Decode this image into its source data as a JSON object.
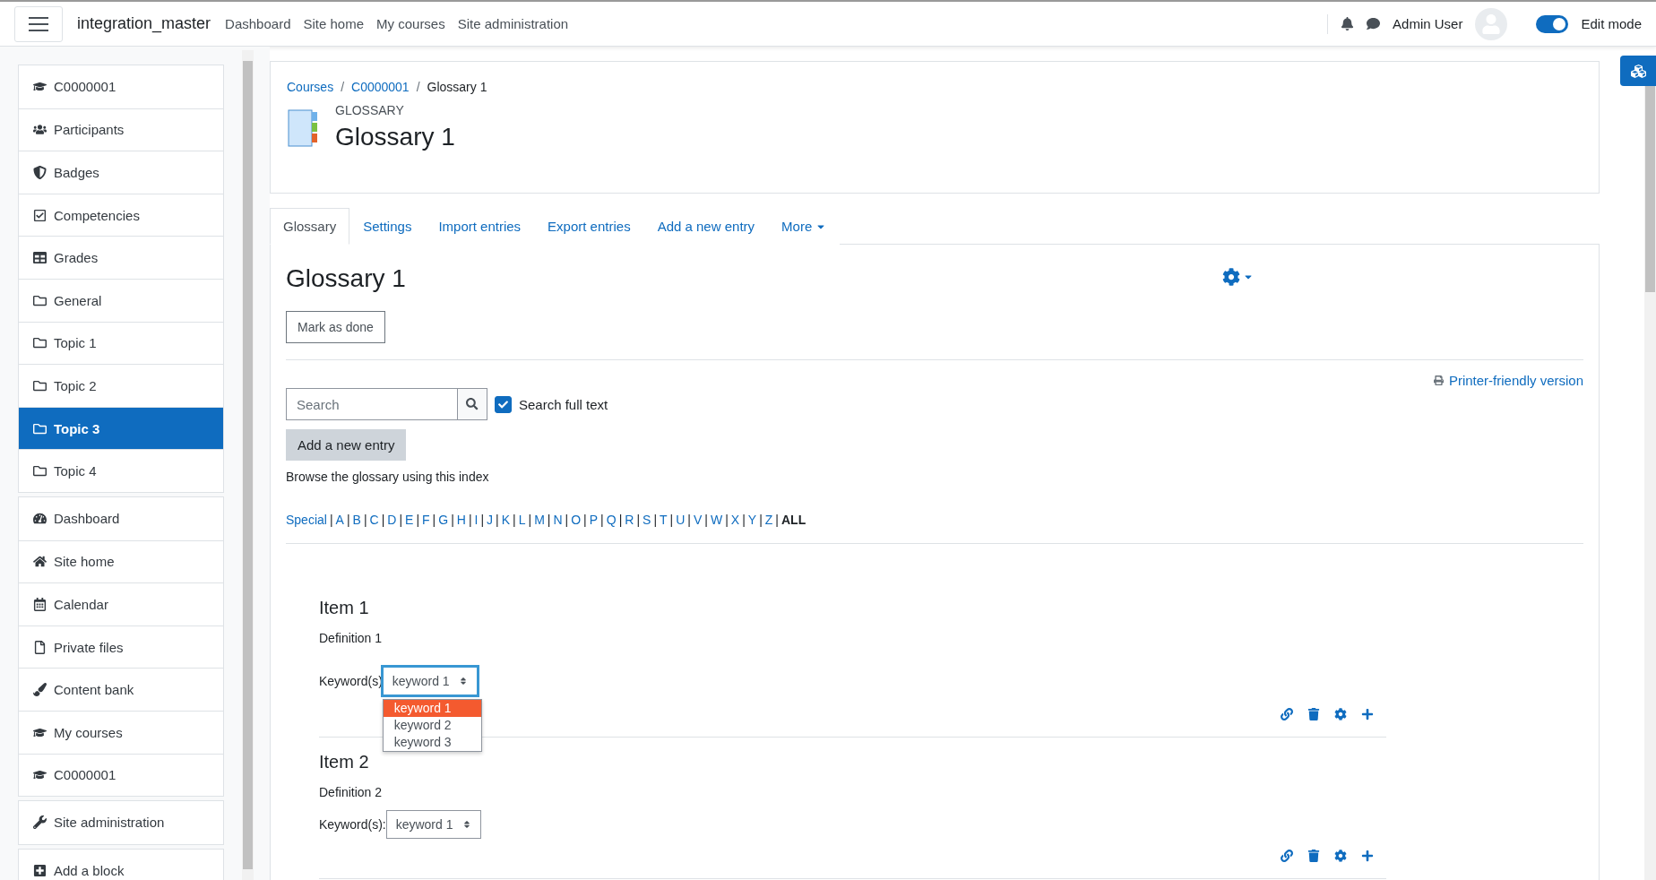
{
  "navbar": {
    "brand": "integration_master",
    "links": [
      "Dashboard",
      "Site home",
      "My courses",
      "Site administration"
    ],
    "user_name": "Admin User",
    "edit_mode": {
      "label": "Edit mode",
      "on": true
    }
  },
  "sidebar": {
    "groups": [
      {
        "items": [
          {
            "label": "C0000001",
            "selected": false
          },
          {
            "label": "Participants",
            "selected": false
          },
          {
            "label": "Badges",
            "selected": false
          },
          {
            "label": "Competencies",
            "selected": false
          },
          {
            "label": "Grades",
            "selected": false
          },
          {
            "label": "General",
            "selected": false
          },
          {
            "label": "Topic 1",
            "selected": false
          },
          {
            "label": "Topic 2",
            "selected": false
          },
          {
            "label": "Topic 3",
            "selected": true
          },
          {
            "label": "Topic 4",
            "selected": false
          }
        ]
      },
      {
        "items": [
          {
            "label": "Dashboard",
            "selected": false
          },
          {
            "label": "Site home",
            "selected": false
          },
          {
            "label": "Calendar",
            "selected": false
          },
          {
            "label": "Private files",
            "selected": false
          },
          {
            "label": "Content bank",
            "selected": false
          },
          {
            "label": "My courses",
            "selected": false
          },
          {
            "label": "C0000001",
            "selected": false
          }
        ]
      },
      {
        "items": [
          {
            "label": "Site administration",
            "selected": false
          }
        ]
      },
      {
        "items": [
          {
            "label": "Add a block",
            "selected": false
          }
        ]
      }
    ]
  },
  "header": {
    "breadcrumb": [
      {
        "label": "Courses"
      },
      {
        "label": "C0000001",
        "sep": "/"
      },
      {
        "label": "Glossary 1",
        "sep": "/"
      }
    ],
    "module_type": "GLOSSARY",
    "title": "Glossary 1"
  },
  "tabs": [
    {
      "label": "Glossary",
      "selected": true,
      "kind": "link"
    },
    {
      "label": "Settings",
      "selected": false,
      "kind": "link"
    },
    {
      "label": "Import entries",
      "selected": false,
      "kind": "link"
    },
    {
      "label": "Export entries",
      "selected": false,
      "kind": "link"
    },
    {
      "label": "Add a new entry",
      "selected": false,
      "kind": "link"
    },
    {
      "label": "More",
      "selected": false,
      "kind": "menu"
    }
  ],
  "content": {
    "title": "Glossary 1",
    "mark_done": "Mark as done",
    "printer_link": "Printer-friendly version",
    "search": {
      "placeholder": "Search"
    },
    "full_text": {
      "label": "Search full text",
      "checked": true
    },
    "add_entry": "Add a new entry",
    "browse_text": "Browse the glossary using this index",
    "index": [
      {
        "label": "Special",
        "selected": false
      },
      {
        "label": "A",
        "sep": "|",
        "selected": false
      },
      {
        "label": "B",
        "sep": "|",
        "selected": false
      },
      {
        "label": "C",
        "sep": "|",
        "selected": false
      },
      {
        "label": "D",
        "sep": "|",
        "selected": false
      },
      {
        "label": "E",
        "sep": "|",
        "selected": false
      },
      {
        "label": "F",
        "sep": "|",
        "selected": false
      },
      {
        "label": "G",
        "sep": "|",
        "selected": false
      },
      {
        "label": "H",
        "sep": "|",
        "selected": false
      },
      {
        "label": "I",
        "sep": "|",
        "selected": false
      },
      {
        "label": "J",
        "sep": "|",
        "selected": false
      },
      {
        "label": "K",
        "sep": "|",
        "selected": false
      },
      {
        "label": "L",
        "sep": "|",
        "selected": false
      },
      {
        "label": "M",
        "sep": "|",
        "selected": false
      },
      {
        "label": "N",
        "sep": "|",
        "selected": false
      },
      {
        "label": "O",
        "sep": "|",
        "selected": false
      },
      {
        "label": "P",
        "sep": "|",
        "selected": false
      },
      {
        "label": "Q",
        "sep": "|",
        "selected": false
      },
      {
        "label": "R",
        "sep": "|",
        "selected": false
      },
      {
        "label": "S",
        "sep": "|",
        "selected": false
      },
      {
        "label": "T",
        "sep": "|",
        "selected": false
      },
      {
        "label": "U",
        "sep": "|",
        "selected": false
      },
      {
        "label": "V",
        "sep": "|",
        "selected": false
      },
      {
        "label": "W",
        "sep": "|",
        "selected": false
      },
      {
        "label": "X",
        "sep": "|",
        "selected": false
      },
      {
        "label": "Y",
        "sep": "|",
        "selected": false
      },
      {
        "label": "Z",
        "sep": "|",
        "selected": false
      },
      {
        "label": "ALL",
        "sep": "|",
        "selected": true
      }
    ],
    "entries": [
      {
        "title": "Item 1",
        "definition": "Definition 1",
        "keyword_label": "Keyword(s)",
        "keyword": "keyword 1",
        "expanded": true,
        "options": [
          {
            "label": "keyword 1",
            "selected": true
          },
          {
            "label": "keyword 2",
            "selected": false
          },
          {
            "label": "keyword 3",
            "selected": false
          }
        ]
      },
      {
        "title": "Item 2",
        "definition": "Definition 2",
        "keyword_label": "Keyword(s):",
        "keyword": "keyword 1",
        "expanded": false
      }
    ]
  }
}
